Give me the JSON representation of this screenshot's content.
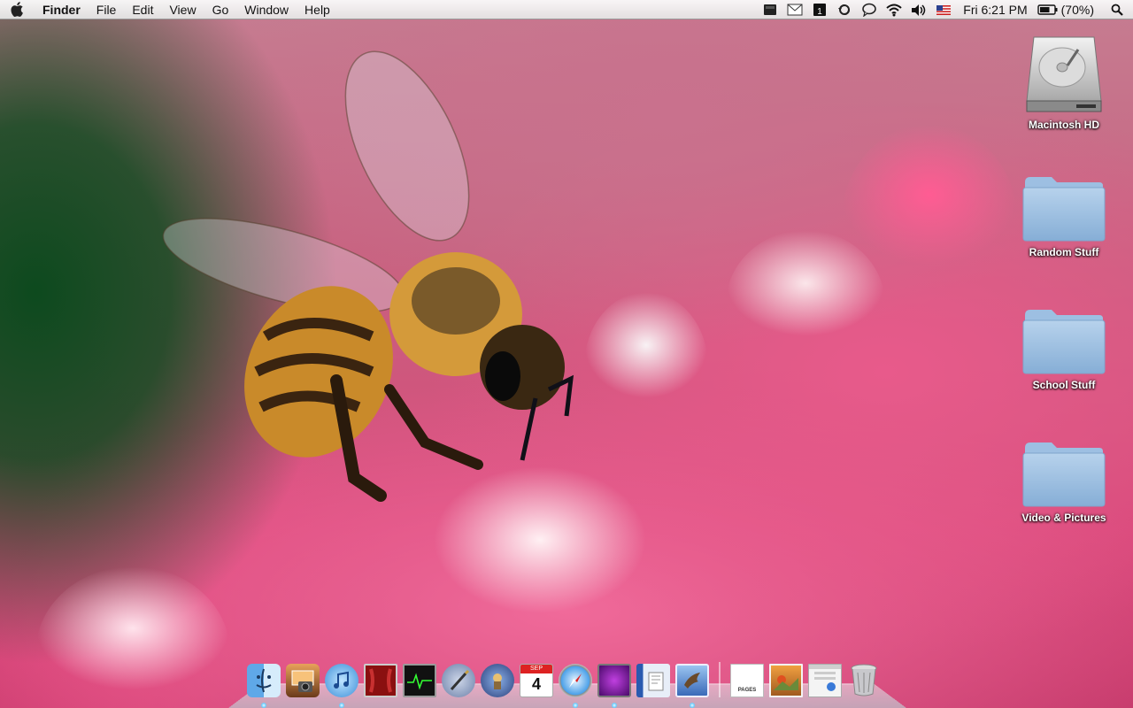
{
  "menubar": {
    "app_name": "Finder",
    "items": [
      "File",
      "Edit",
      "View",
      "Go",
      "Window",
      "Help"
    ],
    "clock": "Fri 6:21 PM",
    "battery": "(70%)",
    "battery_level": 0.7
  },
  "desktop": {
    "icons": [
      {
        "label": "Macintosh HD",
        "icon": "hard-drive-icon"
      },
      {
        "label": "Random Stuff",
        "icon": "folder-icon"
      },
      {
        "label": "School Stuff",
        "icon": "folder-icon"
      },
      {
        "label": "Video & Pictures",
        "icon": "folder-icon"
      }
    ]
  },
  "dock": {
    "calendar_month": "SEP",
    "calendar_day": "4",
    "pages_label": "PAGES",
    "apps": [
      "finder-icon",
      "iphoto-icon",
      "itunes-icon",
      "photo-booth-icon",
      "activity-monitor-icon",
      "script-editor-icon",
      "instruments-icon",
      "ical-icon",
      "safari-icon",
      "dashboard-icon",
      "preview-icon",
      "mail-icon",
      "pages-icon",
      "pictures-stack-icon",
      "applications-stack-icon",
      "trash-icon"
    ]
  }
}
